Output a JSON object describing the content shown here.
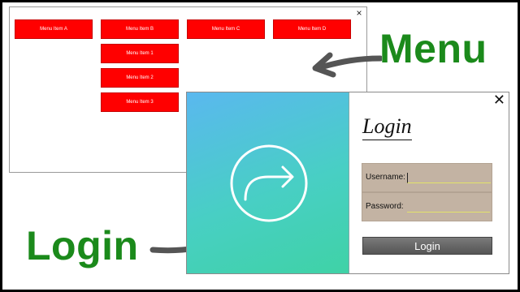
{
  "menu": {
    "close_symbol": "×",
    "items": [
      {
        "label": "Menu Item A"
      },
      {
        "label": "Menu Item B"
      },
      {
        "label": "Menu Item C"
      },
      {
        "label": "Menu Item D"
      }
    ],
    "submenu": [
      {
        "label": "Menu Item 1"
      },
      {
        "label": "Menu Item 2"
      },
      {
        "label": "Menu Item 3"
      }
    ]
  },
  "labels": {
    "menu": "Menu",
    "login": "Login"
  },
  "login": {
    "close_symbol": "✕",
    "title": "Login",
    "username_label": "Username:",
    "password_label": "Password:",
    "button_label": "Login",
    "icon": "arrow-right-circle-icon"
  },
  "colors": {
    "menu_button": "#ff0000",
    "label_green": "#1b8a1b",
    "field_bg": "#c3b3a3",
    "gradient_start": "#5ab8ef",
    "gradient_end": "#3fd2a6"
  }
}
